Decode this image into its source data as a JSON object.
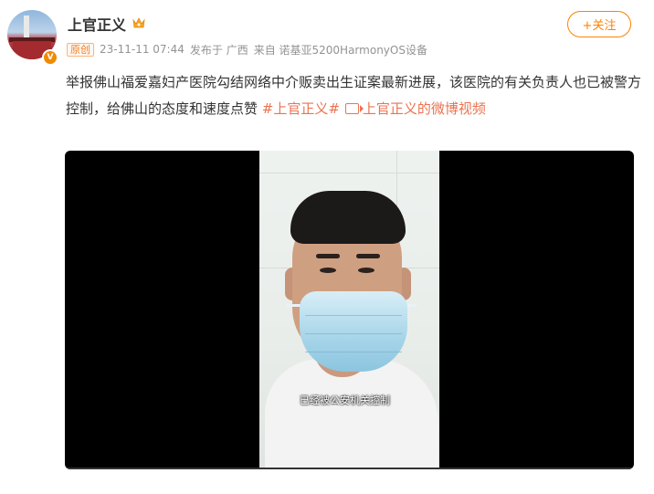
{
  "post": {
    "username": "上官正义",
    "original_badge": "原创",
    "timestamp": "23-11-11 07:44",
    "location": "发布于 广西",
    "source": "来自 诺基亚5200HarmonyOS设备",
    "follow_label": "+关注",
    "text": "举报佛山福爱嘉妇产医院勾结网络中介贩卖出生证案最新进展，该医院的有关负责人也已被警方控制，给佛山的态度和速度点赞 ",
    "hashtag": "#上官正义#",
    "video_link": "上官正义的微博视频"
  },
  "video": {
    "subtitle": "已经被公安机关控制"
  },
  "colors": {
    "accent": "#ff8200",
    "link": "#eb7350",
    "meta": "#939393"
  }
}
